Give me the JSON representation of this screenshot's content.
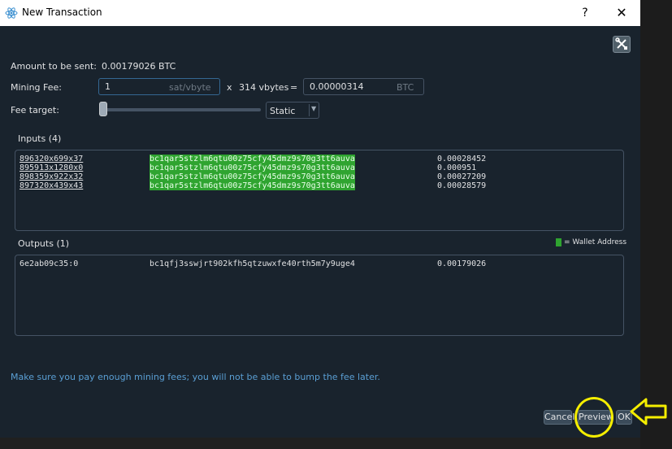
{
  "window": {
    "title": "New Transaction",
    "help_label": "?",
    "close_label": "✕",
    "app_icon": "react-atom-icon"
  },
  "tools_button": {
    "icon": "tools-icon"
  },
  "form": {
    "amount_label": "Amount to be sent:",
    "amount_value": "0.00179026 BTC",
    "fee_label": "Mining Fee:",
    "fee_rate_value": "1",
    "fee_rate_unit": "sat/vbyte",
    "times_sign": "x",
    "vbytes": "314 vbytes",
    "equals_sign": "=",
    "fee_total_value": "0.00000314",
    "fee_total_unit": "BTC",
    "fee_target_label": "Fee target:",
    "fee_target_slider_level": 0,
    "fee_mode": "Static"
  },
  "inputs": {
    "label": "Inputs (4)",
    "rows": [
      {
        "outpoint": "896320x699x37",
        "address": "bc1qar5stzlm6qtu00z75cfy45dmz9s70g3tt6auva",
        "amount": "0.00028452"
      },
      {
        "outpoint": "895913x1280x0",
        "address": "bc1qar5stzlm6qtu00z75cfy45dmz9s70g3tt6auva",
        "amount": "0.000951"
      },
      {
        "outpoint": "898359x922x32",
        "address": "bc1qar5stzlm6qtu00z75cfy45dmz9s70g3tt6auva",
        "amount": "0.00027209"
      },
      {
        "outpoint": "897320x439x43",
        "address": "bc1qar5stzlm6qtu00z75cfy45dmz9s70g3tt6auva",
        "amount": "0.00028579"
      }
    ]
  },
  "outputs": {
    "label": "Outputs (1)",
    "legend": "= Wallet Address",
    "legend_color": "#2fa430",
    "rows": [
      {
        "outpoint": "6e2ab09c35:0",
        "address": "bc1qfj3sswjrt902kfh5qtzuwxfe40rth5m7y9uge4",
        "amount": "0.00179026"
      }
    ]
  },
  "note": "Make sure you pay enough mining fees; you will not be able to bump the fee later.",
  "buttons": {
    "cancel": "Cancel",
    "preview": "Preview",
    "ok": "OK"
  },
  "annotation_color": "#f5ee00"
}
